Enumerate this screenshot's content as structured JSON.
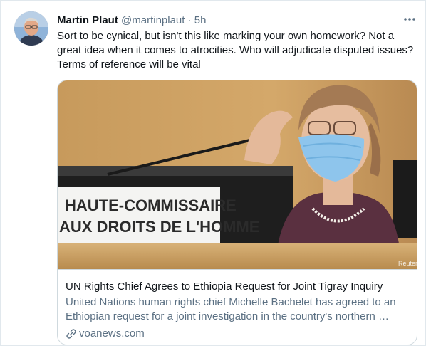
{
  "tweet": {
    "author_name": "Martin Plaut",
    "handle": "@martinplaut",
    "separator": "·",
    "time": "5h",
    "text": "Sort to be cynical, but isn't this like marking your own homework? Not a great idea when it comes to atrocities. Who will adjudicate disputed issues? Terms of reference will be vital"
  },
  "card": {
    "image_sign_line1": "HAUTE-COMMISSAIRE",
    "image_sign_line2": "AUX DROITS DE L'HOMME",
    "image_credit": "Reuters",
    "title": "UN Rights Chief Agrees to Ethiopia Request for Joint Tigray Inquiry",
    "description": "United Nations human rights chief Michelle Bachelet has agreed to an Ethiopian request for a joint investigation in the country's northern …",
    "domain": "voanews.com"
  },
  "icons": {
    "more": "more-horizontal-icon",
    "link": "link-icon"
  },
  "colors": {
    "text_primary": "#0f1419",
    "text_secondary": "#5b7083",
    "border": "#cfd9de"
  }
}
